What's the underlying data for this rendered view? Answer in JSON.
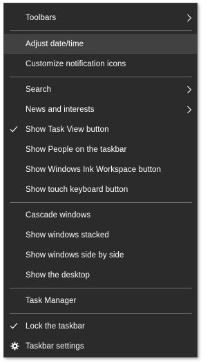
{
  "menu": {
    "items": [
      {
        "label": "Toolbars"
      },
      {
        "label": "Adjust date/time"
      },
      {
        "label": "Customize notification icons"
      },
      {
        "label": "Search"
      },
      {
        "label": "News and interests"
      },
      {
        "label": "Show Task View button"
      },
      {
        "label": "Show People on the taskbar"
      },
      {
        "label": "Show Windows Ink Workspace button"
      },
      {
        "label": "Show touch keyboard button"
      },
      {
        "label": "Cascade windows"
      },
      {
        "label": "Show windows stacked"
      },
      {
        "label": "Show windows side by side"
      },
      {
        "label": "Show the desktop"
      },
      {
        "label": "Task Manager"
      },
      {
        "label": "Lock the taskbar"
      },
      {
        "label": "Taskbar settings"
      }
    ]
  },
  "icons": {
    "submenu": "chevron-right-icon",
    "checked": "checkmark-icon",
    "settings": "gear-icon"
  },
  "colors": {
    "menu_background": "#2b2b2b",
    "hover_background": "#414141",
    "text": "#ffffff",
    "separator": "#6e6e6e"
  }
}
